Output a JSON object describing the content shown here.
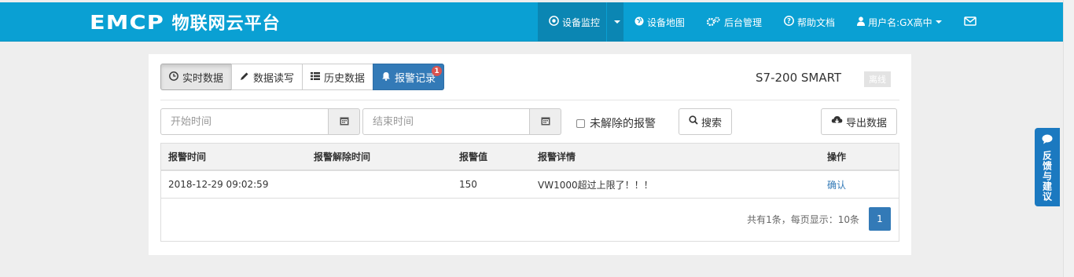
{
  "brand": {
    "logo": "EMCP",
    "title": "物联网云平台"
  },
  "nav": {
    "items": [
      {
        "icon": "eye-icon",
        "label": "设备监控",
        "active": true
      },
      {
        "icon": "globe-icon",
        "label": "设备地图"
      },
      {
        "icon": "gears-icon",
        "label": "后台管理"
      },
      {
        "icon": "question-icon",
        "label": "帮助文档"
      },
      {
        "icon": "user-icon",
        "label": "用户名:GX高中"
      },
      {
        "icon": "envelope-icon",
        "label": ""
      }
    ]
  },
  "tabs": [
    {
      "icon": "clock-icon",
      "label": "实时数据"
    },
    {
      "icon": "pencil-icon",
      "label": "数据读写"
    },
    {
      "icon": "list-icon",
      "label": "历史数据"
    },
    {
      "icon": "bell-icon",
      "label": "报警记录",
      "badge": "1"
    }
  ],
  "device": {
    "name": "S7-200 SMART",
    "status": "离线"
  },
  "filters": {
    "start_placeholder": "开始时间",
    "end_placeholder": "结束时间",
    "unresolved_label": "未解除的报警",
    "search_label": "搜索",
    "export_label": "导出数据"
  },
  "table": {
    "columns": [
      "报警时间",
      "报警解除时间",
      "报警值",
      "报警详情",
      "操作"
    ],
    "rows": [
      {
        "time": "2018-12-29 09:02:59",
        "resolved_time": "",
        "value": "150",
        "detail": "VW1000超过上限了！！！",
        "action": "确认"
      }
    ]
  },
  "pagination": {
    "info": "共有1条，每页显示：10条",
    "current_page": "1"
  },
  "feedback": {
    "label": "反馈与建议"
  },
  "colors": {
    "nav": "#0aa0d3",
    "primary": "#337ab7",
    "badge": "#d9534f",
    "feedback": "#1b79c0"
  }
}
